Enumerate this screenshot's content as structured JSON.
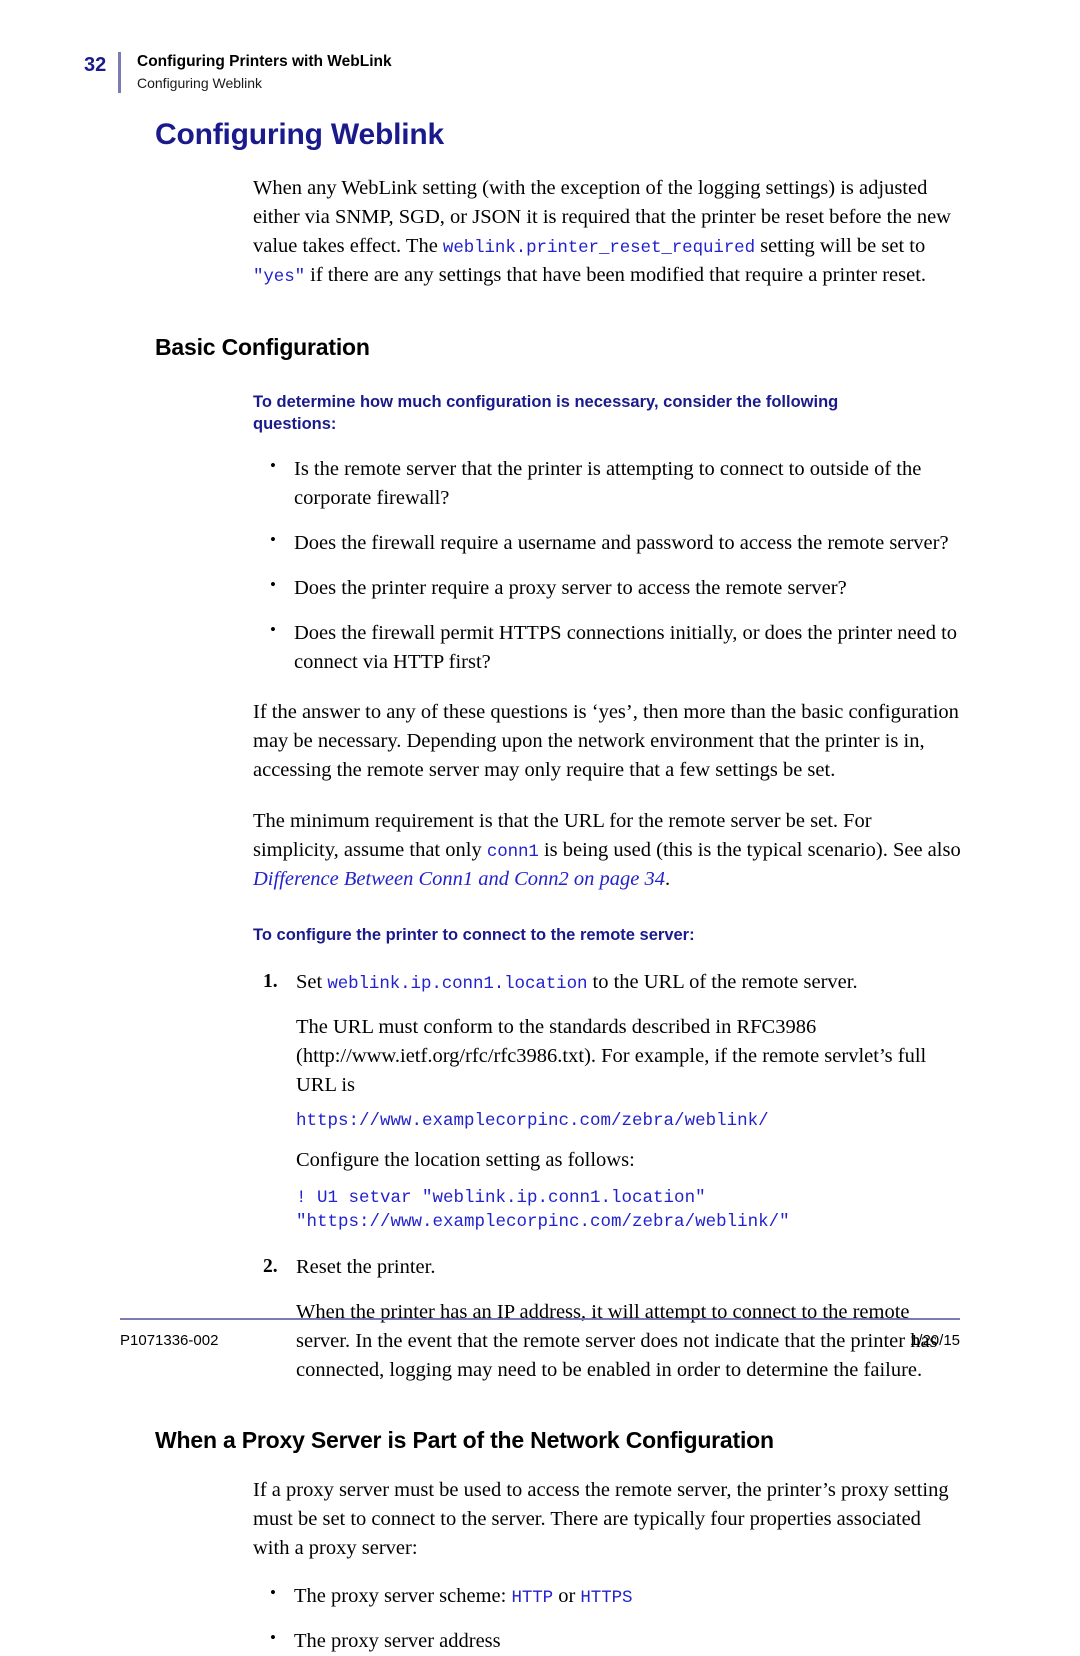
{
  "header": {
    "page_number": "32",
    "title": "Configuring Printers with WebLink",
    "subtitle": "Configuring Weblink"
  },
  "main": {
    "h1": "Configuring Weblink",
    "intro": {
      "part1": "When any WebLink setting (with the exception of the logging settings) is adjusted either via SNMP, SGD, or JSON it is required that the printer be reset before the new value takes effect. The ",
      "code1": "weblink.printer_reset_required",
      "part2": " setting will be set to ",
      "code2": "\"yes\"",
      "part3": " if there are any settings that have been modified that require a printer reset."
    },
    "basic_config": {
      "heading": "Basic Configuration",
      "subheading": "To determine how much configuration is necessary, consider the following questions:",
      "questions": [
        "Is the remote server that the printer is attempting to connect to outside of the corporate firewall?",
        "Does the firewall require a username and password to access the remote server?",
        "Does the printer require a proxy server to access the remote server?",
        "Does the firewall permit HTTPS connections initially, or does the printer need to connect via HTTP first?"
      ],
      "para_answer": "If the answer to any of these questions is ‘yes’, then more than the basic configuration may be necessary. Depending upon the network environment that the printer is in, accessing the remote server may only require that a few settings be set.",
      "para_minimum": {
        "part1": "The minimum requirement is that the URL for the remote server be set. For simplicity, assume that only ",
        "code1": "conn1",
        "part2": " is being used (this is the typical scenario). See also ",
        "xref": "Difference Between Conn1 and Conn2",
        "part3": " on page ",
        "xref_page": "34",
        "part4": "."
      }
    },
    "configure_steps": {
      "heading": "To configure the printer to connect to the remote server:",
      "step1": {
        "num": "1.",
        "text_before": "Set ",
        "code": "weblink.ip.conn1.location",
        "text_after": " to the URL of the remote server."
      },
      "step1_para": "The URL must conform to the standards described in RFC3986 (http://www.ietf.org/rfc/rfc3986.txt). For example, if the remote servlet’s full URL is",
      "step1_url": "https://www.examplecorpinc.com/zebra/weblink/",
      "step1_configure": "Configure the location setting as follows:",
      "step1_code": "! U1 setvar \"weblink.ip.conn1.location\"\n\"https://www.examplecorpinc.com/zebra/weblink/\"",
      "step2": {
        "num": "2.",
        "text": "Reset the printer."
      },
      "step2_para": "When the printer has an IP address, it will attempt to connect to the remote server. In the event that the remote server does not indicate that the printer has connected, logging may need to be enabled in order to determine the failure."
    },
    "proxy_section": {
      "heading": "When a Proxy Server is Part of the Network Configuration",
      "intro": "If a proxy server must be used to access the remote server, the printer’s proxy setting must be set to connect to the server. There are typically four properties associated with a proxy server:",
      "bullet1": {
        "text_before": "The proxy server scheme: ",
        "code1": "HTTP",
        "text_middle": " or ",
        "code2": "HTTPS"
      },
      "bullet2": "The proxy server address"
    }
  },
  "footer": {
    "doc_number": "P1071336-002",
    "date": "1/20/15"
  },
  "colors": {
    "heading_blue": "#1a1a8c",
    "code_blue": "#2222cc",
    "rule_blue": "#7b7bb5"
  }
}
